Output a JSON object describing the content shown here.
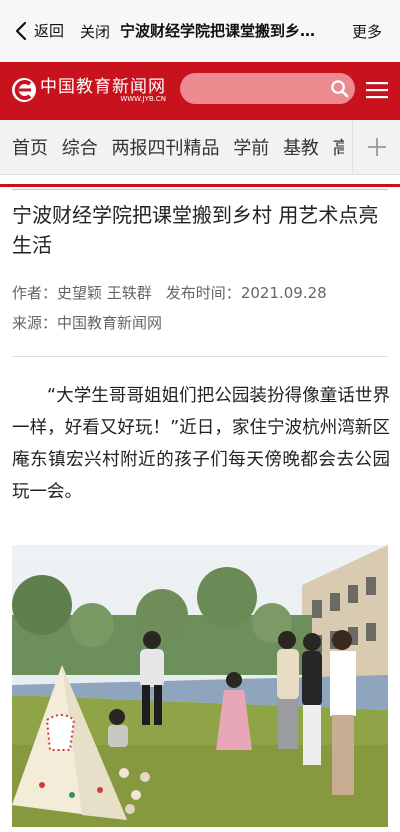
{
  "navbar": {
    "back_label": "返回",
    "close_label": "关闭",
    "title": "宁波财经学院把课堂搬到乡…",
    "more_label": "更多"
  },
  "brand": {
    "logo_cn": "中国教育新闻网",
    "logo_en": "WWW.JYB.CN",
    "search_placeholder": ""
  },
  "tabs": {
    "items": [
      "首页",
      "综合",
      "两报四刊精品",
      "学前",
      "基教",
      "高"
    ]
  },
  "article": {
    "title": "宁波财经学院把课堂搬到乡村 用艺术点亮生活",
    "author_label": "作者：",
    "authors": "史望颖 王轶群",
    "time_label": "发布时间：",
    "time": "2021.09.28",
    "source_label": "来源：",
    "source": "中国教育新闻网",
    "paragraph": "“大学生哥哥姐姐们把公园装扮得像童话世界一样，好看又好玩！”近日，家住宁波杭州湾新区庵东镇宏兴村附近的孩子们每天傍晚都会去公园玩一会。"
  },
  "colors": {
    "brand_red": "#c8121e",
    "nav_bg": "#f7f7f7"
  }
}
